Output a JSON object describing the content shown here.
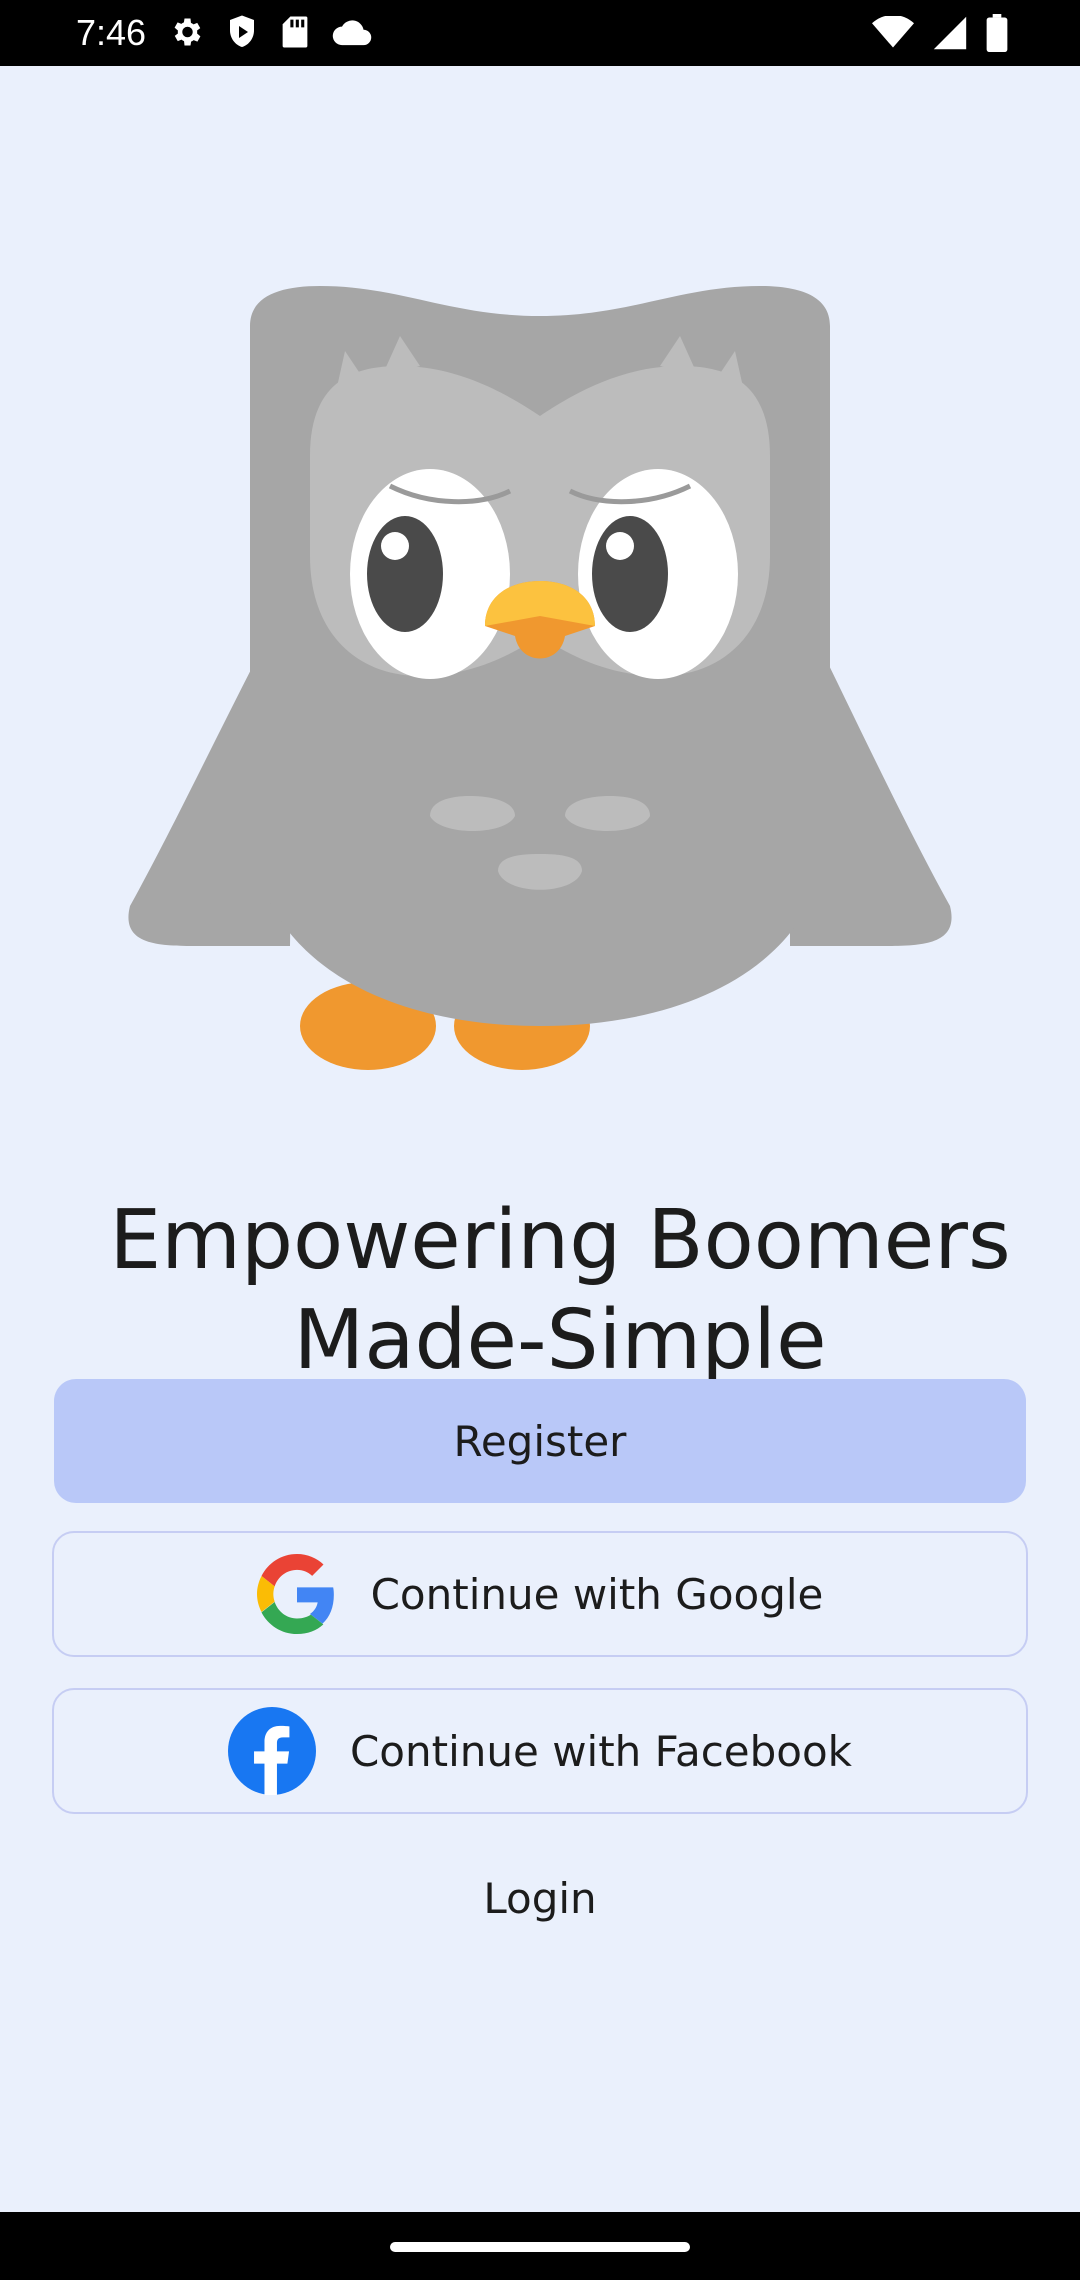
{
  "status_bar": {
    "time": "7:46",
    "left_icons": [
      "settings-icon",
      "shield-icon",
      "sd-card-icon",
      "cloud-icon"
    ],
    "right_icons": [
      "wifi-icon",
      "signal-icon",
      "battery-icon"
    ]
  },
  "mascot": {
    "icon": "owl-mascot-icon",
    "colors": {
      "body": "#a6a6a6",
      "face": "#bcbcbc",
      "beak": "#fcc23f",
      "feet": "#f0982f"
    }
  },
  "headline": {
    "line1": "Empowering Boomers",
    "line2": "Made-Simple"
  },
  "actions": {
    "register_label": "Register",
    "google_label": "Continue with Google",
    "facebook_label": "Continue with Facebook",
    "login_label": "Login"
  },
  "colors": {
    "background": "#eaf0fc",
    "register_button": "#b9c8f8",
    "outline": "#c6cdf3",
    "facebook": "#1877f2"
  }
}
